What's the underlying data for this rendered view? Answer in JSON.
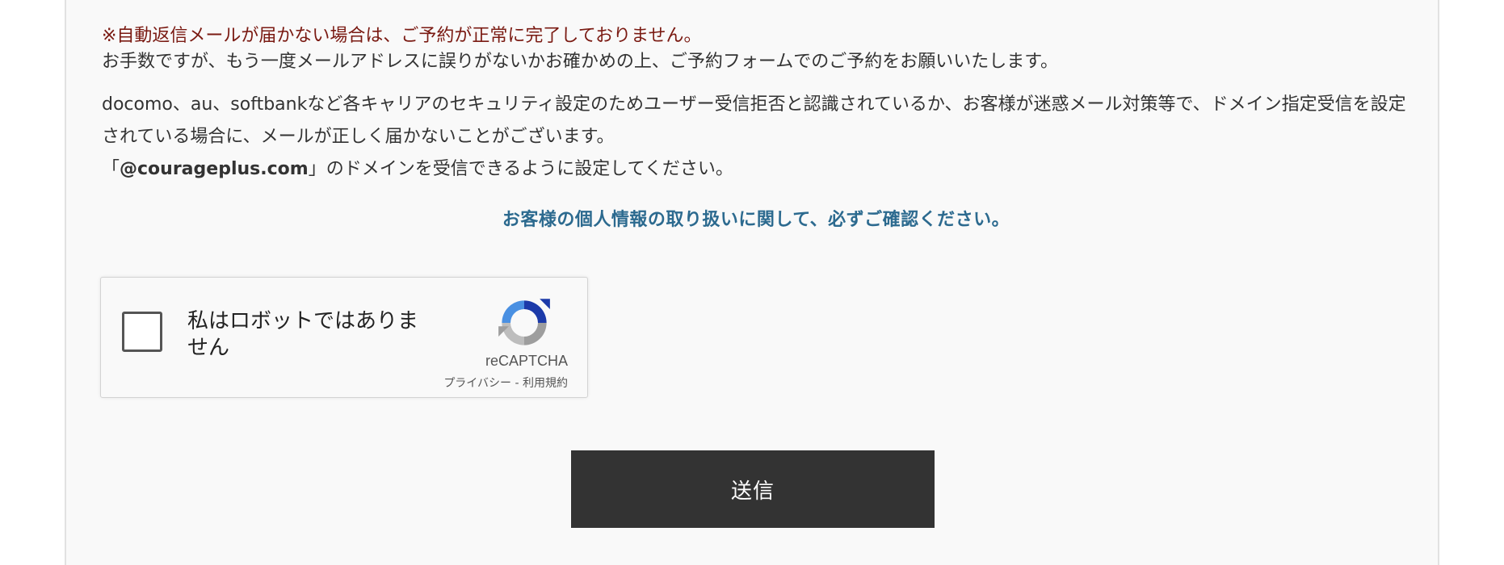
{
  "notice": {
    "warning": "※自動返信メールが届かない場合は、ご予約が正常に完了しておりません。",
    "instruction": "お手数ですが、もう一度メールアドレスに誤りがないかお確かめの上、ご予約フォームでのご予約をお願いいたします。",
    "carrier_note": "docomo、au、softbankなど各キャリアのセキュリティ設定のためユーザー受信拒否と認識されているか、お客様が迷惑メール対策等で、ドメイン指定受信を設定されている場合に、メールが正しく届かないことがございます。",
    "domain_prefix": "「",
    "domain": "@courageplus.com",
    "domain_suffix": "」のドメインを受信できるように設定してください。"
  },
  "privacy_link": "お客様の個人情報の取り扱いに関して、必ずご確認ください。",
  "recaptcha": {
    "label": "私はロボットではありません",
    "brand": "reCAPTCHA",
    "privacy": "プライバシー",
    "separator": " - ",
    "terms": "利用規約",
    "icon": "recaptcha-logo-icon"
  },
  "submit_label": "送信",
  "colors": {
    "warning": "#7a1a12",
    "link": "#2c6a8f",
    "button": "#333333"
  }
}
